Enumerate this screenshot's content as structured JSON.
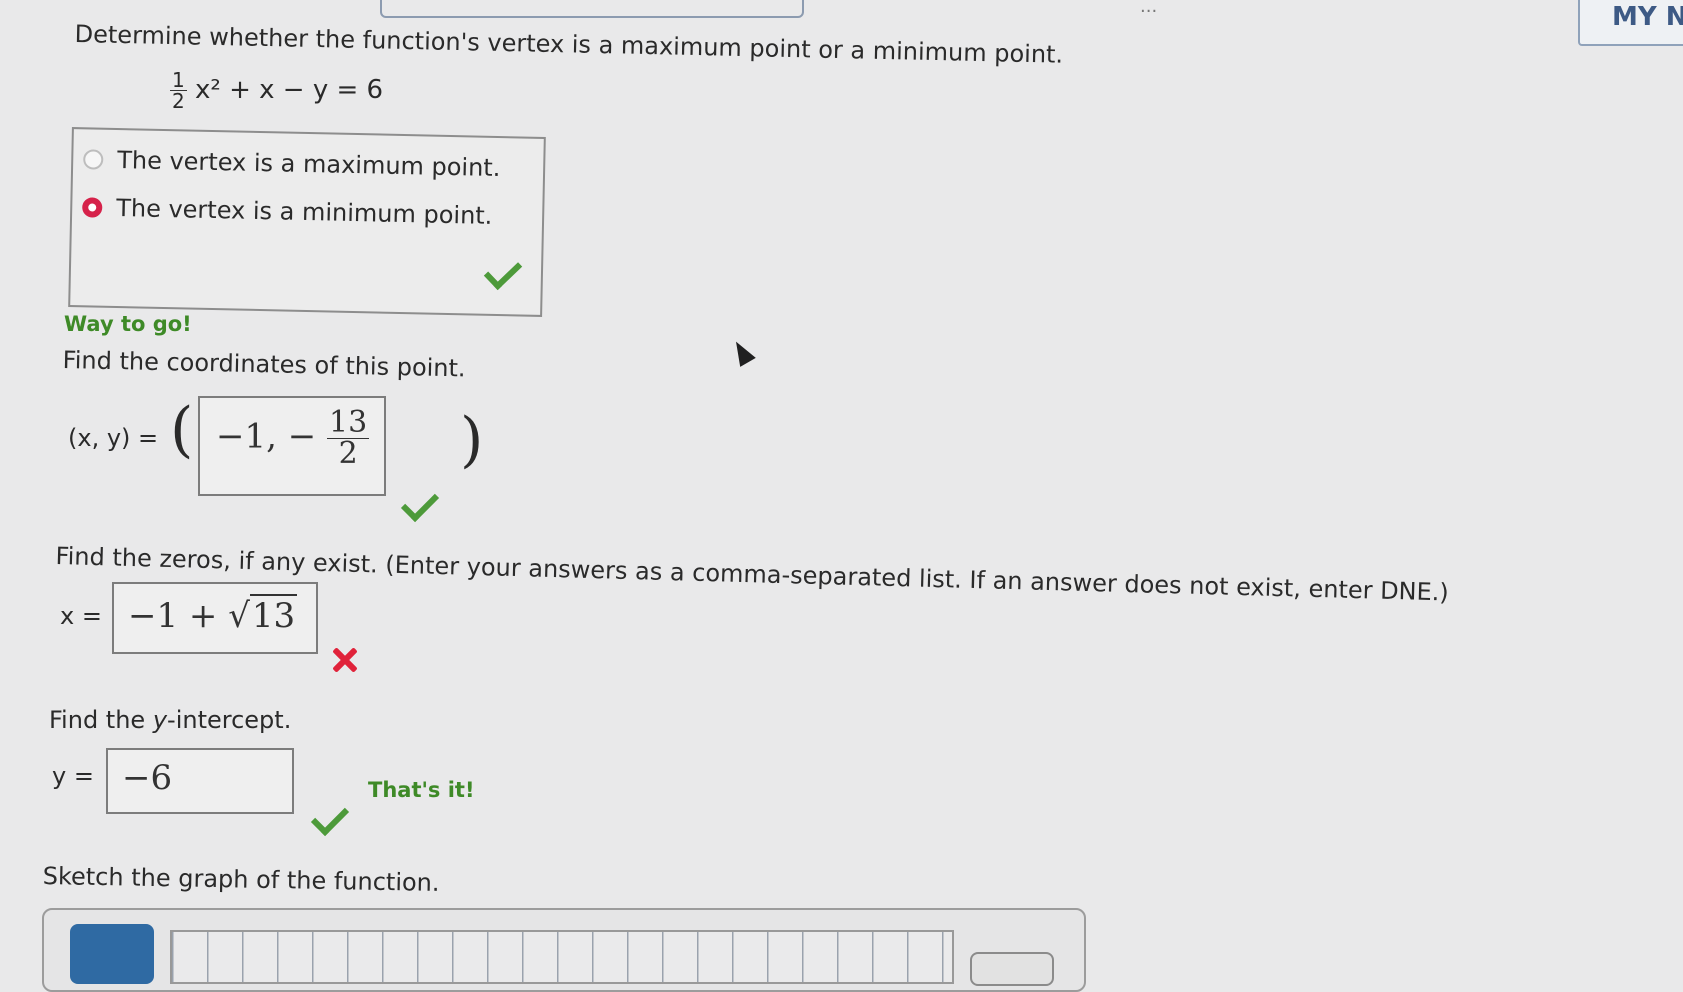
{
  "topbar": {
    "partial_text": "...",
    "my_button_label": "MY N"
  },
  "question": {
    "prompt": "Determine whether the function's vertex is a maximum point or a minimum point.",
    "equation": {
      "frac_num": "1",
      "frac_den": "2",
      "rest": "x² + x − y = 6"
    }
  },
  "choices": [
    {
      "label": "The vertex is a maximum point.",
      "selected": false
    },
    {
      "label": "The vertex is a minimum point.",
      "selected": true
    }
  ],
  "feedback": {
    "first": "Way to go!",
    "second": "That's it!"
  },
  "coords": {
    "prompt": "Find the coordinates of this point.",
    "lhs": "(x, y) =",
    "open_paren": "(",
    "close_paren": ")",
    "answer_x": "−1, −",
    "answer_frac_num": "13",
    "answer_frac_den": "2"
  },
  "zeros": {
    "prompt": "Find the zeros, if any exist. (Enter your answers as a comma-separated list. If an answer does not exist, enter DNE.)",
    "lhs": "x =",
    "answer_prefix": "−1 +",
    "answer_radicand": "13"
  },
  "yint": {
    "prompt_pre": "Find the ",
    "prompt_var": "y",
    "prompt_post": "-intercept.",
    "lhs": "y =",
    "answer": "−6"
  },
  "sketch": {
    "prompt": "Sketch the graph of the function."
  },
  "colors": {
    "accent_red": "#d6224a",
    "correct_green": "#4d9a3a",
    "wrong_red": "#e0223a",
    "tool_blue": "#2f6aa3"
  }
}
